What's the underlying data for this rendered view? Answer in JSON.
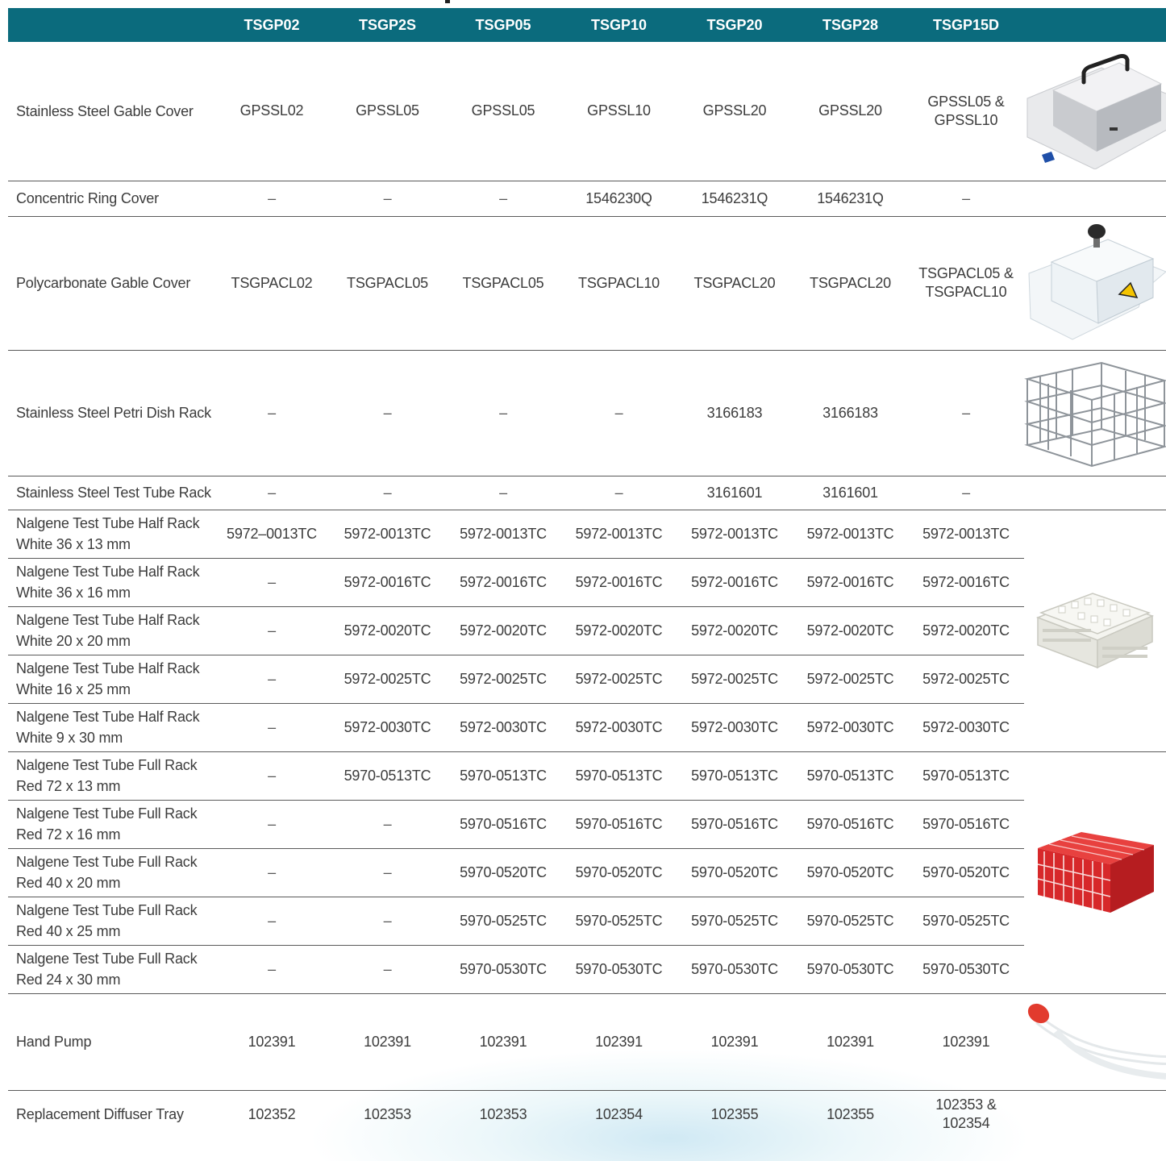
{
  "header": {
    "columns": [
      "",
      "TSGP02",
      "TSGP2S",
      "TSGP05",
      "TSGP10",
      "TSGP20",
      "TSGP28",
      "TSGP15D",
      ""
    ]
  },
  "rows": [
    {
      "label": "Stainless Steel Gable Cover",
      "values": [
        "GPSSL02",
        "GPSSL05",
        "GPSSL05",
        "GPSSL10",
        "GPSSL20",
        "GPSSL20",
        "GPSSL05 &\nGPSSL10"
      ]
    },
    {
      "label": "Concentric Ring Cover",
      "values": [
        "–",
        "–",
        "–",
        "1546230Q",
        "1546231Q",
        "1546231Q",
        "–"
      ]
    },
    {
      "label": "Polycarbonate Gable Cover",
      "values": [
        "TSGPACL02",
        "TSGPACL05",
        "TSGPACL05",
        "TSGPACL10",
        "TSGPACL20",
        "TSGPACL20",
        "TSGPACL05 &\nTSGPACL10"
      ]
    },
    {
      "label": "Stainless Steel Petri Dish Rack",
      "values": [
        "–",
        "–",
        "–",
        "–",
        "3166183",
        "3166183",
        "–"
      ]
    },
    {
      "label": "Stainless Steel Test Tube Rack",
      "values": [
        "–",
        "–",
        "–",
        "–",
        "3161601",
        "3161601",
        "–"
      ]
    },
    {
      "label": "Nalgene Test Tube Half Rack\nWhite 36 x 13 mm",
      "values": [
        "5972–0013TC",
        "5972-0013TC",
        "5972-0013TC",
        "5972-0013TC",
        "5972-0013TC",
        "5972-0013TC",
        "5972-0013TC"
      ]
    },
    {
      "label": "Nalgene Test Tube Half Rack\nWhite 36 x 16 mm",
      "values": [
        "–",
        "5972-0016TC",
        "5972-0016TC",
        "5972-0016TC",
        "5972-0016TC",
        "5972-0016TC",
        "5972-0016TC"
      ]
    },
    {
      "label": "Nalgene Test Tube Half Rack\nWhite 20 x 20 mm",
      "values": [
        "–",
        "5972-0020TC",
        "5972-0020TC",
        "5972-0020TC",
        "5972-0020TC",
        "5972-0020TC",
        "5972-0020TC"
      ]
    },
    {
      "label": "Nalgene Test Tube Half Rack\nWhite 16 x 25 mm",
      "values": [
        "–",
        "5972-0025TC",
        "5972-0025TC",
        "5972-0025TC",
        "5972-0025TC",
        "5972-0025TC",
        "5972-0025TC"
      ]
    },
    {
      "label": "Nalgene Test Tube Half Rack\nWhite 9 x 30 mm",
      "values": [
        "–",
        "5972-0030TC",
        "5972-0030TC",
        "5972-0030TC",
        "5972-0030TC",
        "5972-0030TC",
        "5972-0030TC"
      ]
    },
    {
      "label": "Nalgene Test Tube Full Rack\nRed 72 x 13 mm",
      "values": [
        "–",
        "5970-0513TC",
        "5970-0513TC",
        "5970-0513TC",
        "5970-0513TC",
        "5970-0513TC",
        "5970-0513TC"
      ]
    },
    {
      "label": "Nalgene Test Tube Full Rack\nRed 72 x 16 mm",
      "values": [
        "–",
        "–",
        "5970-0516TC",
        "5970-0516TC",
        "5970-0516TC",
        "5970-0516TC",
        "5970-0516TC"
      ]
    },
    {
      "label": "Nalgene Test Tube Full Rack\nRed 40 x 20 mm",
      "values": [
        "–",
        "–",
        "5970-0520TC",
        "5970-0520TC",
        "5970-0520TC",
        "5970-0520TC",
        "5970-0520TC"
      ]
    },
    {
      "label": "Nalgene Test Tube Full Rack\nRed 40 x 25 mm",
      "values": [
        "–",
        "–",
        "5970-0525TC",
        "5970-0525TC",
        "5970-0525TC",
        "5970-0525TC",
        "5970-0525TC"
      ]
    },
    {
      "label": "Nalgene Test Tube Full Rack\nRed 24 x 30 mm",
      "values": [
        "–",
        "–",
        "5970-0530TC",
        "5970-0530TC",
        "5970-0530TC",
        "5970-0530TC",
        "5970-0530TC"
      ]
    },
    {
      "label": "Hand Pump",
      "values": [
        "102391",
        "102391",
        "102391",
        "102391",
        "102391",
        "102391",
        "102391"
      ]
    },
    {
      "label": "Replacement Diffuser Tray",
      "values": [
        "102352",
        "102353",
        "102353",
        "102354",
        "102355",
        "102355",
        "102353 &\n102354"
      ]
    }
  ],
  "images": {
    "gable_cover": "stainless-steel-gable-cover-photo",
    "poly_cover": "polycarbonate-gable-cover-photo",
    "petri_rack": "petri-dish-rack-photo",
    "half_rack": "white-half-rack-photo",
    "full_rack": "red-full-rack-photo",
    "hand_pump": "hand-pump-photo"
  },
  "colors": {
    "header_bg": "#0b6b7d",
    "header_text": "#ffffff",
    "row_border": "#5a5a5a",
    "body_text": "#3c3c3c",
    "rack_red": "#e3262b",
    "rack_white": "#f2f2ec"
  }
}
